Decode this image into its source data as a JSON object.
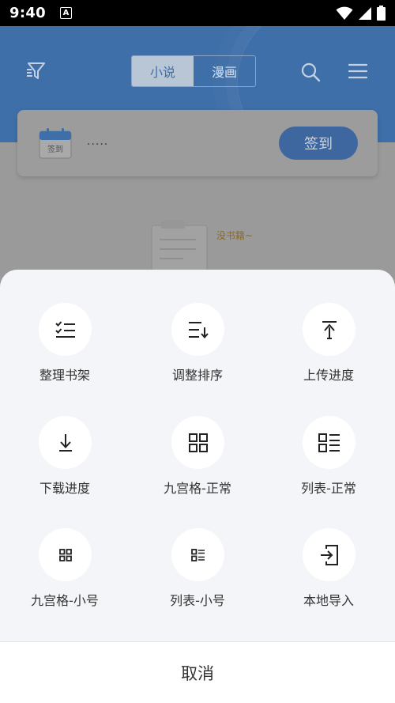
{
  "status_bar": {
    "time": "9:40",
    "notif_glyph": "A"
  },
  "header": {
    "tabs": [
      {
        "label": "小说",
        "active": true
      },
      {
        "label": "漫画",
        "active": false
      }
    ],
    "icons": [
      "filter-icon",
      "search-icon",
      "menu-icon"
    ]
  },
  "signin_card": {
    "calendar_label": "签到",
    "text": "·····",
    "button_label": "签到"
  },
  "empty_state": {
    "text": "没书籍~"
  },
  "sheet": {
    "items": [
      {
        "label": "整理书架",
        "icon": "checklist-icon"
      },
      {
        "label": "调整排序",
        "icon": "sort-icon"
      },
      {
        "label": "上传进度",
        "icon": "upload-icon"
      },
      {
        "label": "下载进度",
        "icon": "download-icon"
      },
      {
        "label": "九宫格-正常",
        "icon": "grid-icon"
      },
      {
        "label": "列表-正常",
        "icon": "list-icon"
      },
      {
        "label": "九宫格-小号",
        "icon": "grid-small-icon"
      },
      {
        "label": "列表-小号",
        "icon": "list-small-icon"
      },
      {
        "label": "本地导入",
        "icon": "import-icon"
      }
    ],
    "cancel_label": "取消"
  },
  "colors": {
    "header_bg": "#3f6fa8",
    "sheet_bg": "#f4f5f9",
    "accent": "#3e67a0"
  }
}
